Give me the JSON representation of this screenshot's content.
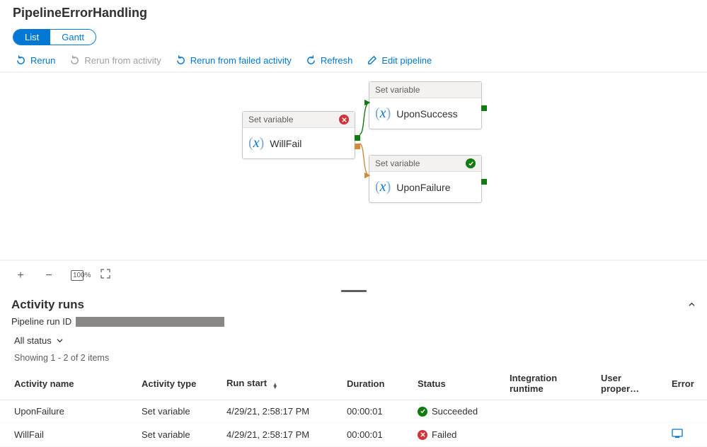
{
  "pageTitle": "PipelineErrorHandling",
  "viewTabs": {
    "list": "List",
    "gantt": "Gantt"
  },
  "toolbar": {
    "rerun": "Rerun",
    "rerunFromActivity": "Rerun from activity",
    "rerunFromFailed": "Rerun from failed activity",
    "refresh": "Refresh",
    "edit": "Edit pipeline"
  },
  "nodes": {
    "willFail": {
      "type": "Set variable",
      "name": "WillFail"
    },
    "uponSuccess": {
      "type": "Set variable",
      "name": "UponSuccess"
    },
    "uponFailure": {
      "type": "Set variable",
      "name": "UponFailure"
    }
  },
  "activityRuns": {
    "heading": "Activity runs",
    "runIdLabel": "Pipeline run ID",
    "filterLabel": "All status",
    "showing": "Showing 1 - 2 of 2 items",
    "columns": {
      "name": "Activity name",
      "type": "Activity type",
      "start": "Run start",
      "duration": "Duration",
      "status": "Status",
      "runtime": "Integration runtime",
      "userProps": "User proper…",
      "error": "Error"
    },
    "rows": [
      {
        "name": "UponFailure",
        "type": "Set variable",
        "start": "4/29/21, 2:58:17 PM",
        "duration": "00:00:01",
        "status": "Succeeded",
        "statusKind": "ok"
      },
      {
        "name": "WillFail",
        "type": "Set variable",
        "start": "4/29/21, 2:58:17 PM",
        "duration": "00:00:01",
        "status": "Failed",
        "statusKind": "err",
        "hasError": true
      }
    ]
  }
}
